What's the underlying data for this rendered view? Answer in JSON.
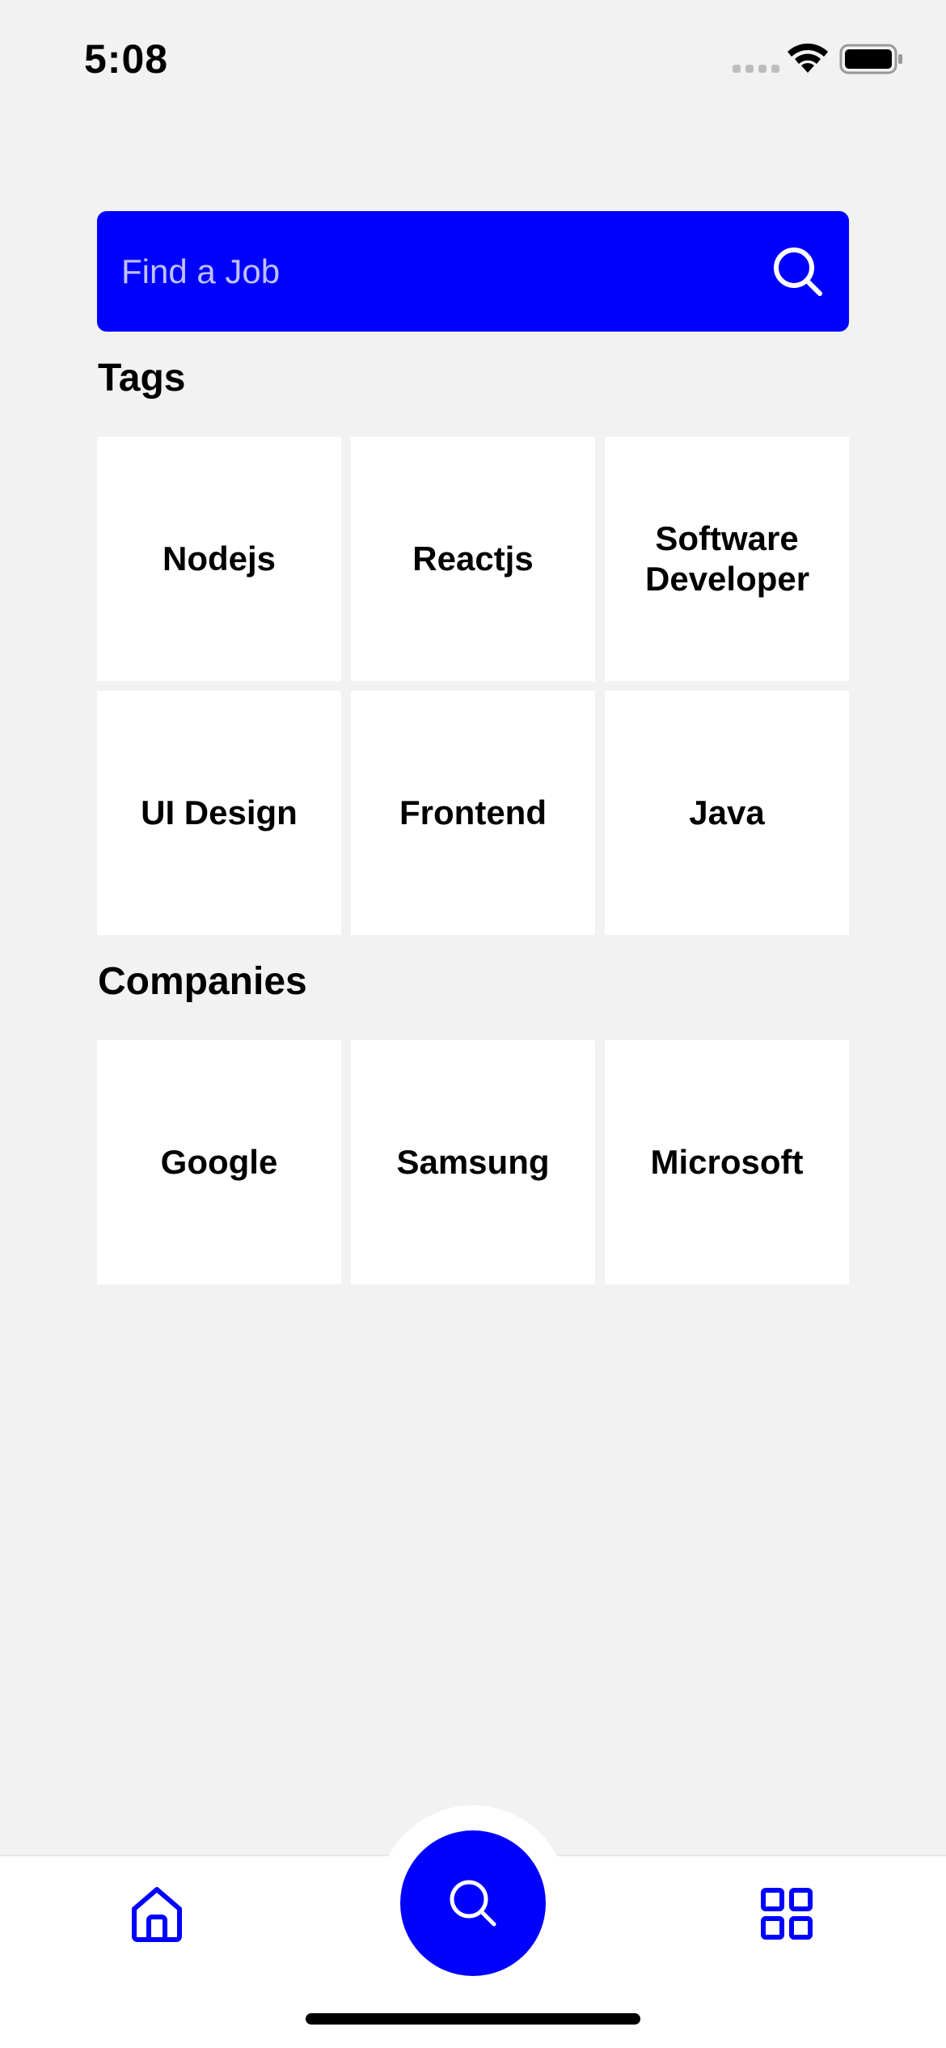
{
  "status_bar": {
    "time": "5:08"
  },
  "search": {
    "placeholder": "Find a Job",
    "value": ""
  },
  "tags": {
    "title": "Tags",
    "items": [
      {
        "label": "Nodejs"
      },
      {
        "label": "Reactjs"
      },
      {
        "label": "Software Developer"
      },
      {
        "label": "UI Design"
      },
      {
        "label": "Frontend"
      },
      {
        "label": "Java"
      }
    ]
  },
  "companies": {
    "title": "Companies",
    "items": [
      {
        "label": "Google"
      },
      {
        "label": "Samsung"
      },
      {
        "label": "Microsoft"
      }
    ]
  },
  "nav": {
    "items": [
      {
        "icon": "home-icon"
      },
      {
        "icon": "search-icon",
        "active": true
      },
      {
        "icon": "grid-icon"
      }
    ]
  },
  "colors": {
    "accent": "#0000ff",
    "background": "#f2f2f2",
    "tile": "#ffffff",
    "text": "#000000"
  }
}
